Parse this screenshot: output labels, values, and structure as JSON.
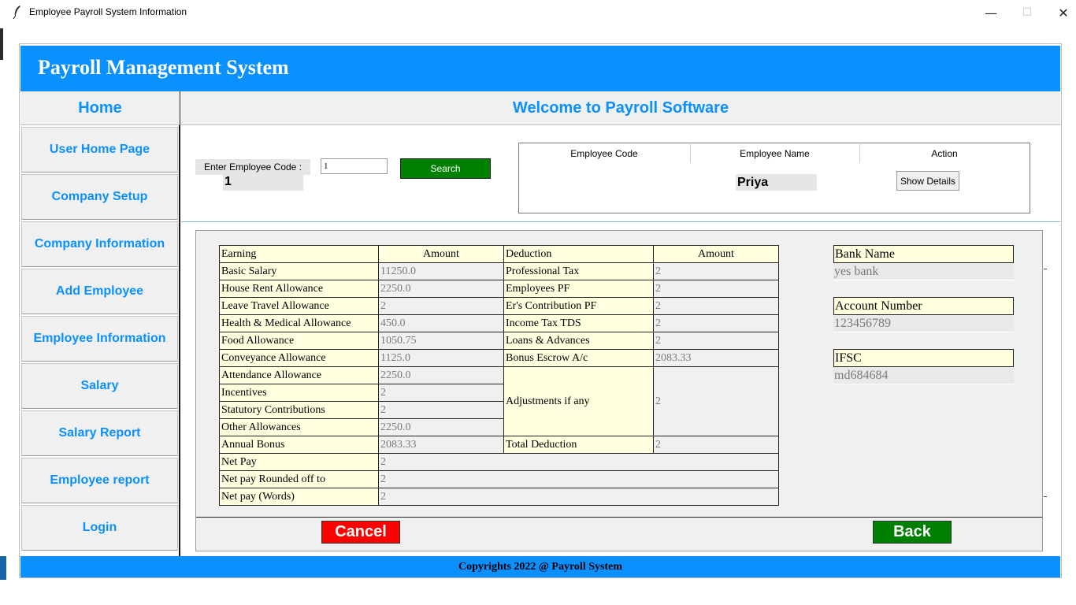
{
  "window": {
    "title": "Employee Payroll System Information",
    "minimize": "—",
    "maximize": "☐",
    "close": "✕"
  },
  "header": {
    "title": "Payroll Management System"
  },
  "sidebar": {
    "home": "Home",
    "items": [
      {
        "label": "User Home Page"
      },
      {
        "label": "Company Setup"
      },
      {
        "label": "Company Information"
      },
      {
        "label": "Add Employee"
      },
      {
        "label": "Employee Information"
      },
      {
        "label": "Salary"
      },
      {
        "label": "Salary Report"
      },
      {
        "label": "Employee report"
      },
      {
        "label": "Login"
      }
    ]
  },
  "welcome": "Welcome to Payroll Software",
  "search": {
    "label": "Enter Employee Code :",
    "code_display": "1",
    "input_value": "1",
    "button": "Search"
  },
  "result": {
    "headers": {
      "code": "Employee Code",
      "name": "Employee Name",
      "action": "Action"
    },
    "employee_name": "Priya",
    "show_details": "Show Details"
  },
  "table": {
    "headers": {
      "earning": "Earning",
      "amount": "Amount",
      "deduction": "Deduction",
      "deduction_amount": "Amount"
    },
    "earnings": [
      {
        "label": "Basic Salary",
        "value": "11250.0"
      },
      {
        "label": "House Rent Allowance",
        "value": "2250.0"
      },
      {
        "label": "Leave Travel Allowance",
        "value": "2"
      },
      {
        "label": "Health & Medical Allowance",
        "value": "450.0"
      },
      {
        "label": "Food Allowance",
        "value": "1050.75"
      },
      {
        "label": "Conveyance Allowance",
        "value": "1125.0"
      },
      {
        "label": "Attendance Allowance",
        "value": "2250.0"
      },
      {
        "label": "Incentives",
        "value": "2"
      },
      {
        "label": "Statutory Contributions",
        "value": "2"
      },
      {
        "label": "Other Allowances",
        "value": "2250.0"
      },
      {
        "label": "Annual Bonus",
        "value": "2083.33"
      }
    ],
    "deductions": [
      {
        "label": "Professional Tax",
        "value": "2"
      },
      {
        "label": "Employees PF",
        "value": "2"
      },
      {
        "label": "Er's Contribution PF",
        "value": "2"
      },
      {
        "label": "Income Tax TDS",
        "value": "2"
      },
      {
        "label": "Loans & Advances",
        "value": "2"
      },
      {
        "label": "Bonus Escrow A/c",
        "value": "2083.33"
      },
      {
        "label": "Adjustments if any",
        "value": "2"
      },
      {
        "label": "Total Deduction",
        "value": "2"
      }
    ],
    "totals": [
      {
        "label": "Net Pay",
        "value": "2"
      },
      {
        "label": "Net pay Rounded off to",
        "value": "2"
      },
      {
        "label": "Net pay (Words)",
        "value": "2"
      }
    ]
  },
  "bank": {
    "name_label": "Bank Name",
    "name_value": "yes bank",
    "account_label": "Account Number",
    "account_value": "123456789",
    "ifsc_label": "IFSC",
    "ifsc_value": "md684684"
  },
  "buttons": {
    "cancel": "Cancel",
    "back": "Back"
  },
  "footer": "Copyrights 2022 @ Payroll System",
  "colors": {
    "brand_blue": "#0a90ff",
    "search_green": "#008000",
    "cancel_red": "#ff0000",
    "label_bg": "#ffffe0"
  }
}
